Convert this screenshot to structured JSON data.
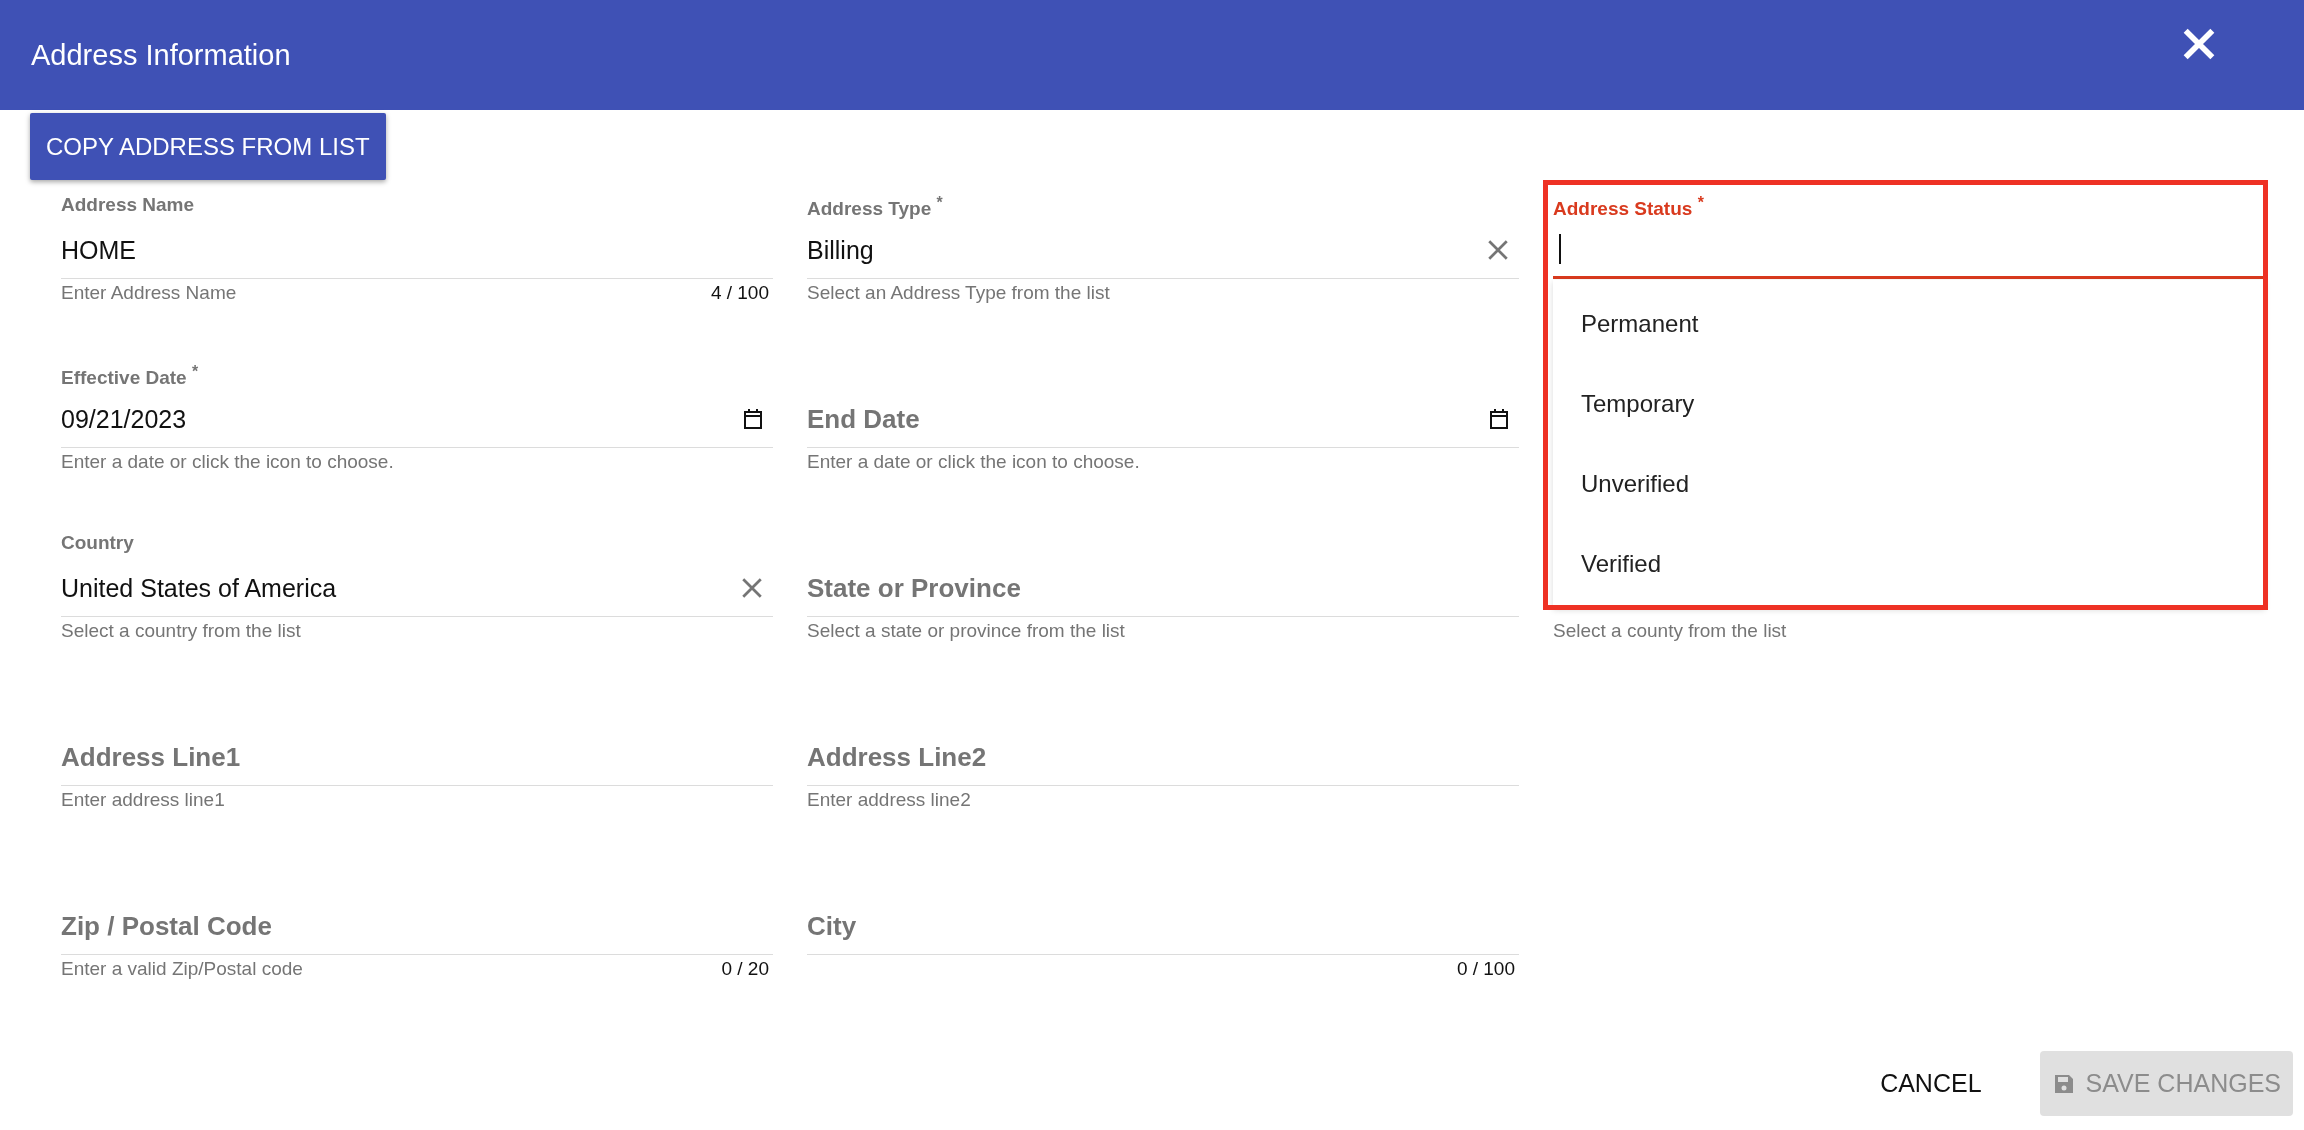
{
  "dialog": {
    "title": "Address Information"
  },
  "copy_button": {
    "label": "COPY ADDRESS FROM LIST"
  },
  "rows": [
    [
      {
        "kind": "text",
        "label": "Address Name",
        "value": "HOME",
        "hint": "Enter Address Name",
        "counter": "4 / 100"
      },
      {
        "kind": "select",
        "label": "Address Type $^{*}$",
        "value": "Billing",
        "hint": "Select an Address Type from the list",
        "clearable": true
      },
      {
        "kind": "select",
        "label": "Address Status $^{*}$",
        "focused": true,
        "highlighted": true,
        "options": [
          {
            "label": "Permanent",
            "selected": false
          },
          {
            "label": "Temporary",
            "selected": false
          },
          {
            "label": "Unverified",
            "selected": false
          },
          {
            "label": "Verified",
            "selected": false
          }
        ]
      }
    ],
    [
      {
        "kind": "date",
        "label": "Effective Date $^{*}$",
        "value": "09/21/2023",
        "hint": "Enter a date or click the icon to choose."
      },
      {
        "kind": "date",
        "label": "End Date",
        "hint": "Enter a date or click the icon to choose."
      }
    ],
    [
      {
        "kind": "select",
        "label": "Country",
        "value": "United States of America",
        "hint": "Select a country from the list",
        "clearable": true
      },
      {
        "kind": "select",
        "label": "State or Province",
        "hint": "Select a state or province from the list"
      },
      {
        "kind": "select",
        "hint": "Select a county from the list"
      }
    ],
    [
      {
        "kind": "text",
        "label": "Address Line1",
        "hint": "Enter address line1"
      },
      {
        "kind": "text",
        "label": "Address Line2",
        "hint": "Enter address line2"
      }
    ],
    [
      {
        "kind": "text",
        "label": "Zip / Postal Code",
        "hint": "Enter a valid Zip/Postal code",
        "counter": "0 / 20"
      },
      {
        "kind": "text",
        "label": "City",
        "counter": "0 / 100"
      }
    ]
  ],
  "buttons": [
    {
      "kind": "text",
      "label": "CANCEL",
      "disabled": false
    },
    {
      "kind": "save",
      "label": "SAVE CHANGES",
      "disabled": true
    }
  ]
}
